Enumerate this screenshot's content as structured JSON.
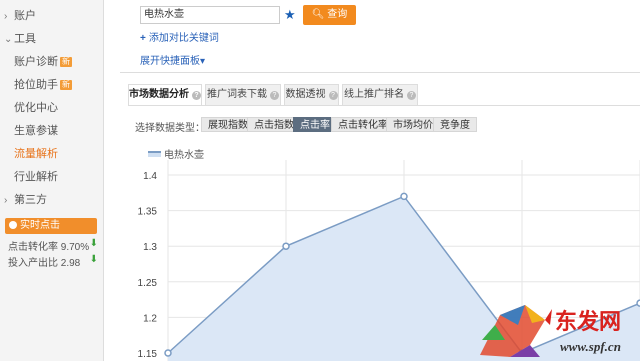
{
  "sidebar": {
    "groups": [
      {
        "label": "账户",
        "expanded": false
      },
      {
        "label": "工具",
        "expanded": true
      },
      {
        "label": "第三方",
        "expanded": false
      }
    ],
    "items": [
      {
        "label": "账户诊断",
        "badge": "新"
      },
      {
        "label": "抢位助手",
        "badge": "新"
      },
      {
        "label": "优化中心"
      },
      {
        "label": "生意参谋"
      },
      {
        "label": "流量解析",
        "active": true
      },
      {
        "label": "行业解析"
      }
    ],
    "realtime_label": "实时点击",
    "stats": [
      {
        "label": "点击转化率",
        "value": "9.70%"
      },
      {
        "label": "投入产出比",
        "value": "2.98"
      }
    ]
  },
  "search": {
    "value": "电热水壶",
    "button_label": "查询",
    "add_compare": "添加对比关键词",
    "expand_panel": "展开快捷面板"
  },
  "tabs": [
    {
      "label": "市场数据分析",
      "active": true
    },
    {
      "label": "推广词表下载"
    },
    {
      "label": "数据透视"
    },
    {
      "label": "线上推广排名"
    }
  ],
  "data_type": {
    "label": "选择数据类型：",
    "options": [
      "展现指数",
      "点击指数",
      "点击率",
      "点击转化率",
      "市场均价",
      "竞争度"
    ],
    "selected": "点击率"
  },
  "chart_data": {
    "type": "area",
    "series": [
      {
        "name": "电热水壶",
        "values": [
          1.15,
          1.3,
          1.37,
          1.15,
          1.22
        ]
      }
    ],
    "x": [
      1,
      2,
      3,
      4,
      5
    ],
    "yticks": [
      "1.15",
      "1.2",
      "1.25",
      "1.3",
      "1.35",
      "1.4"
    ],
    "ylim": [
      1.15,
      1.4
    ],
    "grid": true,
    "colors": {
      "line": "#7b9cc4",
      "fill": "#dbe7f6"
    }
  },
  "watermark": {
    "brand": "东发网",
    "url": "www.spf.cn"
  }
}
